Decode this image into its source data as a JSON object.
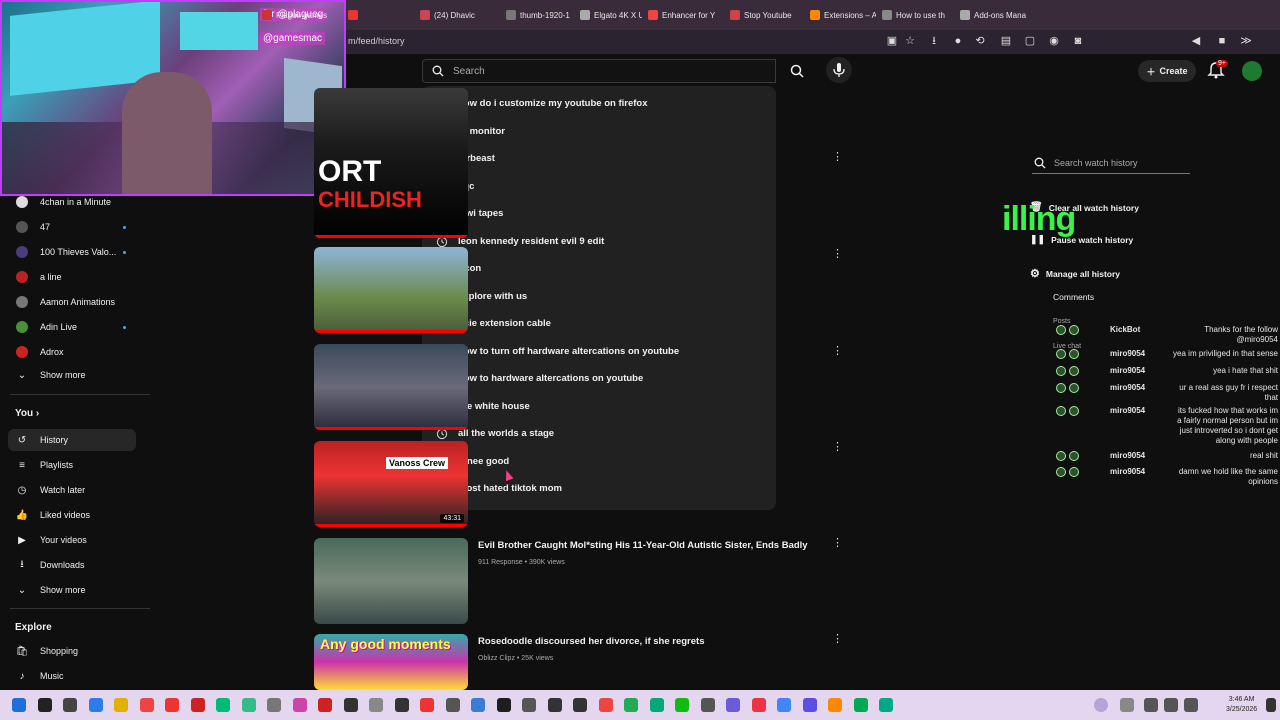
{
  "browser": {
    "tabs": [
      {
        "label": "Plague games",
        "color": "#c33"
      },
      {
        "label": "",
        "color": "#e33"
      },
      {
        "label": "(24) Dhavic",
        "color": "#c45"
      },
      {
        "label": "thumb-1920-1",
        "color": "#777"
      },
      {
        "label": "Elgato 4K X US",
        "color": "#aaa"
      },
      {
        "label": "Enhancer for Y",
        "color": "#e44"
      },
      {
        "label": "Stop Youtube",
        "color": "#c44"
      },
      {
        "label": "Extensions – Ad",
        "color": "#f80"
      },
      {
        "label": "How to use th",
        "color": "#888"
      },
      {
        "label": "Add-ons Mana",
        "color": "#aaa"
      }
    ],
    "url": "m/feed/history"
  },
  "webcam": {
    "handle_top": "for  @plagueg",
    "handle_bottom": "@gamesmac"
  },
  "header": {
    "search_placeholder": "Search",
    "create_label": "Create",
    "notif_count": "9+"
  },
  "sidebar": {
    "channels": [
      {
        "name": "4chan in a Minute",
        "color": "#ddd",
        "dot": false
      },
      {
        "name": "47",
        "color": "#555",
        "dot": true
      },
      {
        "name": "100 Thieves Valo...",
        "color": "#4a3b7a",
        "dot": true
      },
      {
        "name": "a line",
        "color": "#b22",
        "dot": false
      },
      {
        "name": "Aamon Animations",
        "color": "#777",
        "dot": false
      },
      {
        "name": "Adin Live",
        "color": "#4a8f3a",
        "dot": true
      },
      {
        "name": "Adrox",
        "color": "#c22",
        "dot": false
      }
    ],
    "show_more_1": "Show more",
    "you_heading": "You",
    "you_items": [
      {
        "label": "History",
        "icon": "history-icon"
      },
      {
        "label": "Playlists",
        "icon": "playlists-icon"
      },
      {
        "label": "Watch later",
        "icon": "watch-later-icon"
      },
      {
        "label": "Liked videos",
        "icon": "like-icon"
      },
      {
        "label": "Your videos",
        "icon": "your-videos-icon"
      },
      {
        "label": "Downloads",
        "icon": "download-icon"
      }
    ],
    "show_more_2": "Show more",
    "explore_heading": "Explore",
    "explore_items": [
      {
        "label": "Shopping",
        "icon": "shopping-icon"
      },
      {
        "label": "Music",
        "icon": "music-icon"
      }
    ]
  },
  "videos": [
    {
      "thumb_text": "ORT\nCHILDISH",
      "title": "",
      "meta": "",
      "duration": ""
    },
    {
      "thumb_text": "",
      "title": "",
      "meta": "",
      "duration": ""
    },
    {
      "thumb_text": "",
      "title": "",
      "meta": "",
      "duration": ""
    },
    {
      "thumb_text": "Vanoss Crew",
      "title": "",
      "meta": "",
      "duration": "43:31"
    },
    {
      "thumb_text": "",
      "title": "Evil Brother Caught Mol*sting His 11-Year-Old Autistic Sister, Ends Badly",
      "meta": "911 Response • 390K views",
      "duration": ""
    },
    {
      "thumb_text": "Any good moments",
      "title": "Rosedoodle discoursed her divorce, if she regrets",
      "meta": "Oblizz Clipz • 25K views",
      "duration": ""
    }
  ],
  "suggestions": [
    "how do i customize my youtube on firefox",
    "ltt monitor",
    "mrbeast",
    "xqc",
    "kiwi tapes",
    "leon kennedy resident evil 9 edit",
    "tfcon",
    "explore with us",
    "pcie extension cable",
    "how to turn off hardware altercations on youtube",
    "how to hardware altercations on youtube",
    "the white house",
    "all the worlds a stage",
    "renee good",
    "most hated tiktok mom"
  ],
  "right_panel": {
    "search_placeholder": "Search watch history",
    "clear_label": "Clear all watch history",
    "pause_label": "Pause watch history",
    "manage_label": "Manage all history",
    "comments_label": "Comments",
    "posts_label": "Posts",
    "livechat_label": "Live chat",
    "overlay": "illing"
  },
  "chat": [
    {
      "user": "KickBot",
      "msg": "Thanks for the follow\n@miro9054"
    },
    {
      "user": "miro9054",
      "msg": "yea im priviliged in that sense"
    },
    {
      "user": "miro9054",
      "msg": "yea i hate that shit"
    },
    {
      "user": "miro9054",
      "msg": "ur a real ass guy fr i respect\nthat"
    },
    {
      "user": "miro9054",
      "msg": "its fucked how that works im\na fairly normal person but im\njust introverted so i dont get\nalong with people"
    },
    {
      "user": "miro9054",
      "msg": "real shit"
    },
    {
      "user": "miro9054",
      "msg": "damn we hold like the same\nopinions"
    }
  ],
  "taskbar": {
    "time": "3:46 AM",
    "date": "3/25/2026"
  },
  "colors": {
    "accent_red": "#ff0000",
    "overlay_green": "#3cff4e",
    "webcam_border": "#c13cff"
  }
}
